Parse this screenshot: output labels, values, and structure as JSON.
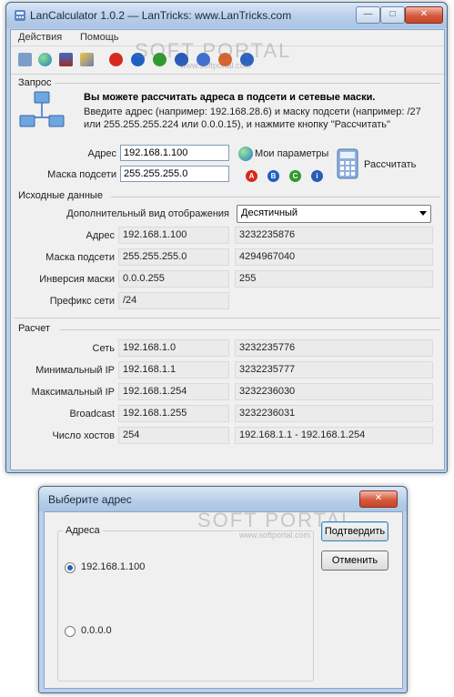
{
  "main_window": {
    "title": "LanCalculator 1.0.2 — LanTricks: www.LanTricks.com",
    "menu": [
      "Действия",
      "Помощь"
    ],
    "toolbar_icons": [
      "clear-icon",
      "globe-icon",
      "network-icon",
      "brush-icon",
      "class-a-icon",
      "class-b-icon",
      "class-c-icon",
      "info-icon",
      "help-icon",
      "settings-icon",
      "info-round-icon"
    ]
  },
  "request": {
    "group_label": "Запрос",
    "headline": "Вы можете рассчитать адреса в подсети и сетевые маски.",
    "instructions_1": "Введите адрес (например: 192.168.28.6) и маску подсети (например: /27",
    "instructions_2": "или 255.255.255.224 или 0.0.0.15), и нажмите кнопку \"Рассчитать\"",
    "address_label": "Адрес",
    "address_value": "192.168.1.100",
    "mask_label": "Маска подсети",
    "mask_value": "255.255.255.0",
    "my_params": "Мои параметры",
    "calculate": "Рассчитать",
    "class_buttons": [
      "A",
      "B",
      "C",
      "i"
    ]
  },
  "source": {
    "group_label": "Исходные данные",
    "view_label": "Дополнительный вид отображения",
    "view_value": "Десятичный",
    "rows": [
      {
        "label": "Адрес",
        "value": "192.168.1.100",
        "extra": "3232235876"
      },
      {
        "label": "Маска подсети",
        "value": "255.255.255.0",
        "extra": "4294967040"
      },
      {
        "label": "Инверсия маски",
        "value": "0.0.0.255",
        "extra": "255"
      },
      {
        "label": "Префикс сети",
        "value": "/24",
        "extra": ""
      }
    ]
  },
  "result": {
    "group_label": "Расчет",
    "rows": [
      {
        "label": "Сеть",
        "value": "192.168.1.0",
        "extra": "3232235776"
      },
      {
        "label": "Минимальный IP",
        "value": "192.168.1.1",
        "extra": "3232235777"
      },
      {
        "label": "Максимальный IP",
        "value": "192.168.1.254",
        "extra": "3232236030"
      },
      {
        "label": "Broadcast",
        "value": "192.168.1.255",
        "extra": "3232236031"
      },
      {
        "label": "Число хостов",
        "value": "254",
        "extra": "192.168.1.1 - 192.168.1.254"
      }
    ]
  },
  "dialog": {
    "title": "Выберите адрес",
    "group_label": "Адреса",
    "options": [
      {
        "label": "192.168.1.100",
        "selected": true
      },
      {
        "label": "0.0.0.0",
        "selected": false
      }
    ],
    "confirm": "Подтвердить",
    "cancel": "Отменить"
  },
  "watermark": {
    "brand": "SOFT PORTAL",
    "url": "www.softportal.com"
  },
  "colors": {
    "class_a": "#d62a1e",
    "class_b": "#1f5fc4",
    "class_c": "#2e9a2e",
    "info": "#2a5bb8",
    "window_frame": "#b9d1ea"
  }
}
